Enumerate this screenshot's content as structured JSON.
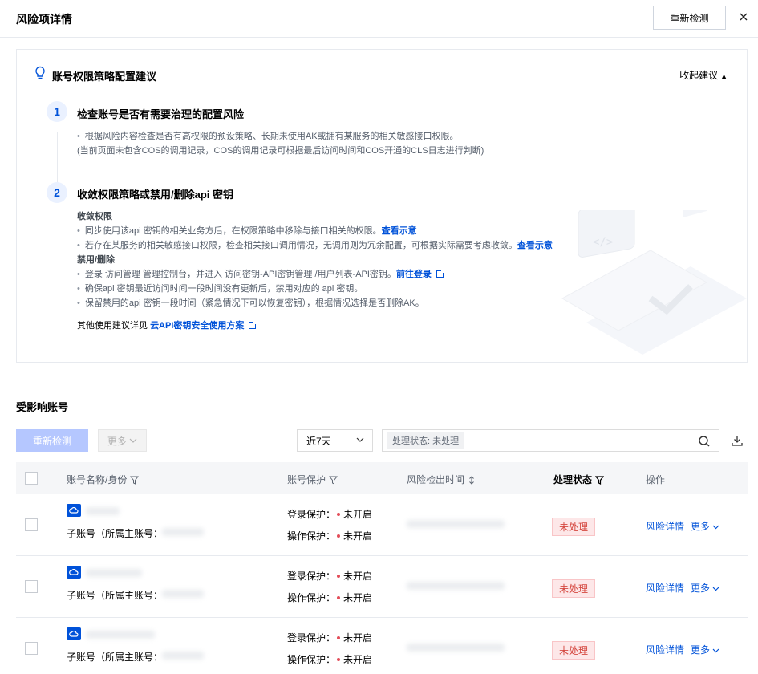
{
  "header": {
    "title": "风险项详情",
    "recheck_label": "重新检测"
  },
  "suggestion": {
    "title": "账号权限策略配置建议",
    "collapse_label": "收起建议",
    "steps": [
      {
        "num": "1",
        "title": "检查账号是否有需要治理的配置风险",
        "lines": [
          "根据风险内容检查是否有高权限的预设策略、长期未使用AK或拥有某服务的相关敏感接口权限。",
          "(当前页面未包含COS的调用记录，COS的调用记录可根据最后访问时间和COS开通的CLS日志进行判断)"
        ]
      },
      {
        "num": "2",
        "title": "收敛权限策略或禁用/删除api 密钥",
        "group1_title": "收敛权限",
        "group1": [
          {
            "text": "同步使用该api 密钥的相关业务方后，在权限策略中移除与接口相关的权限。",
            "link": "查看示意"
          },
          {
            "text": "若存在某服务的相关敏感接口权限，检查相关接口调用情况，无调用则为冗余配置，可根据实际需要考虑收敛。",
            "link": "查看示意"
          }
        ],
        "group2_title": "禁用/删除",
        "group2": [
          {
            "text": "登录 访问管理 管理控制台，并进入 访问密钥-API密钥管理 /用户列表-API密钥。",
            "link": "前往登录"
          },
          {
            "text": "确保api 密钥最近访问时间一段时间没有更新后，禁用对应的 api 密钥。"
          },
          {
            "text": "保留禁用的api 密钥一段时间（紧急情况下可以恢复密钥），根据情况选择是否删除AK。"
          }
        ]
      }
    ],
    "footer_text": "其他使用建议详见",
    "footer_link": "云API密钥安全使用方案"
  },
  "affected": {
    "title": "受影响账号",
    "recheck_label": "重新检测",
    "more_label": "更多",
    "date_range": "近7天",
    "filter_tag": "处理状态: 未处理",
    "columns": [
      "账号名称/身份",
      "账号保护",
      "风险检出时间",
      "处理状态",
      "操作"
    ],
    "rows": [
      {
        "identity": "子账号（所属主账号：",
        "login_label": "登录保护：",
        "login_value": "未开启",
        "op_label": "操作保护：",
        "op_value": "未开启",
        "status": "未处理",
        "detail_label": "风险详情",
        "more_label": "更多"
      },
      {
        "identity": "子账号（所属主账号：",
        "login_label": "登录保护：",
        "login_value": "未开启",
        "op_label": "操作保护：",
        "op_value": "未开启",
        "status": "未处理",
        "detail_label": "风险详情",
        "more_label": "更多"
      },
      {
        "identity": "子账号（所属主账号：",
        "login_label": "登录保护：",
        "login_value": "未开启",
        "op_label": "操作保护：",
        "op_value": "未开启",
        "status": "未处理",
        "detail_label": "风险详情",
        "more_label": "更多"
      }
    ]
  },
  "colors": {
    "brand": "#0052d9",
    "danger": "#d54941",
    "disabled_primary": "#b5c7ff"
  }
}
